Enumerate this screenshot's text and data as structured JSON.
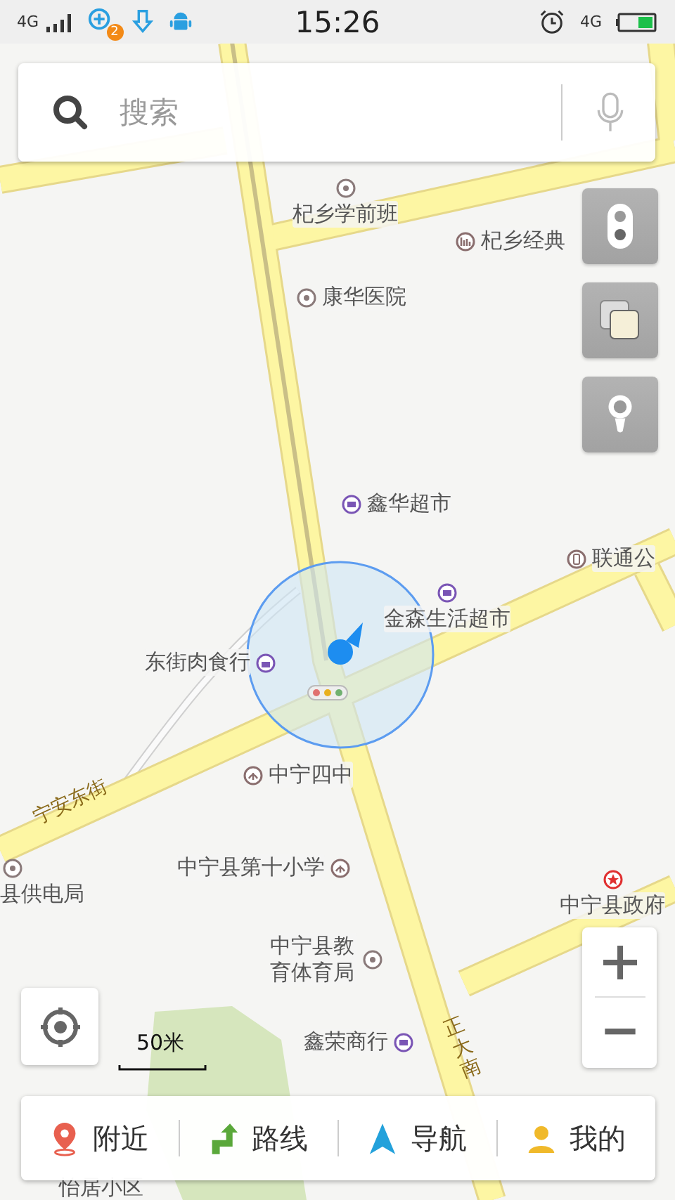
{
  "status_bar": {
    "network": "4G",
    "badge": "2",
    "time": "15:26",
    "data_network": "4G"
  },
  "search": {
    "placeholder": "搜索"
  },
  "pois": [
    {
      "name": "杞乡学前班",
      "kind": "place"
    },
    {
      "name": "杞乡经典",
      "kind": "mall"
    },
    {
      "name": "康华医院",
      "kind": "place"
    },
    {
      "name": "鑫华超市",
      "kind": "market"
    },
    {
      "name": "联通公",
      "kind": "phone"
    },
    {
      "name": "金森生活超市",
      "kind": "market"
    },
    {
      "name": "东街肉食行",
      "kind": "shop"
    },
    {
      "name": "中宁四中",
      "kind": "school"
    },
    {
      "name": "中宁县第十小学",
      "kind": "school"
    },
    {
      "name": "县供电局",
      "kind": "place"
    },
    {
      "name": "中宁县政府",
      "kind": "civic"
    },
    {
      "name": "中宁县教育体育局",
      "kind": "place"
    },
    {
      "name": "鑫荣商行",
      "kind": "market"
    },
    {
      "name": "怡居小区",
      "kind": "label"
    }
  ],
  "road_labels": [
    "宁安东街",
    "正大南"
  ],
  "scale": "50米",
  "bottom_tabs": [
    {
      "label": "附近",
      "kind": "nearby"
    },
    {
      "label": "路线",
      "kind": "route"
    },
    {
      "label": "导航",
      "kind": "navigate"
    },
    {
      "label": "我的",
      "kind": "mine"
    }
  ]
}
